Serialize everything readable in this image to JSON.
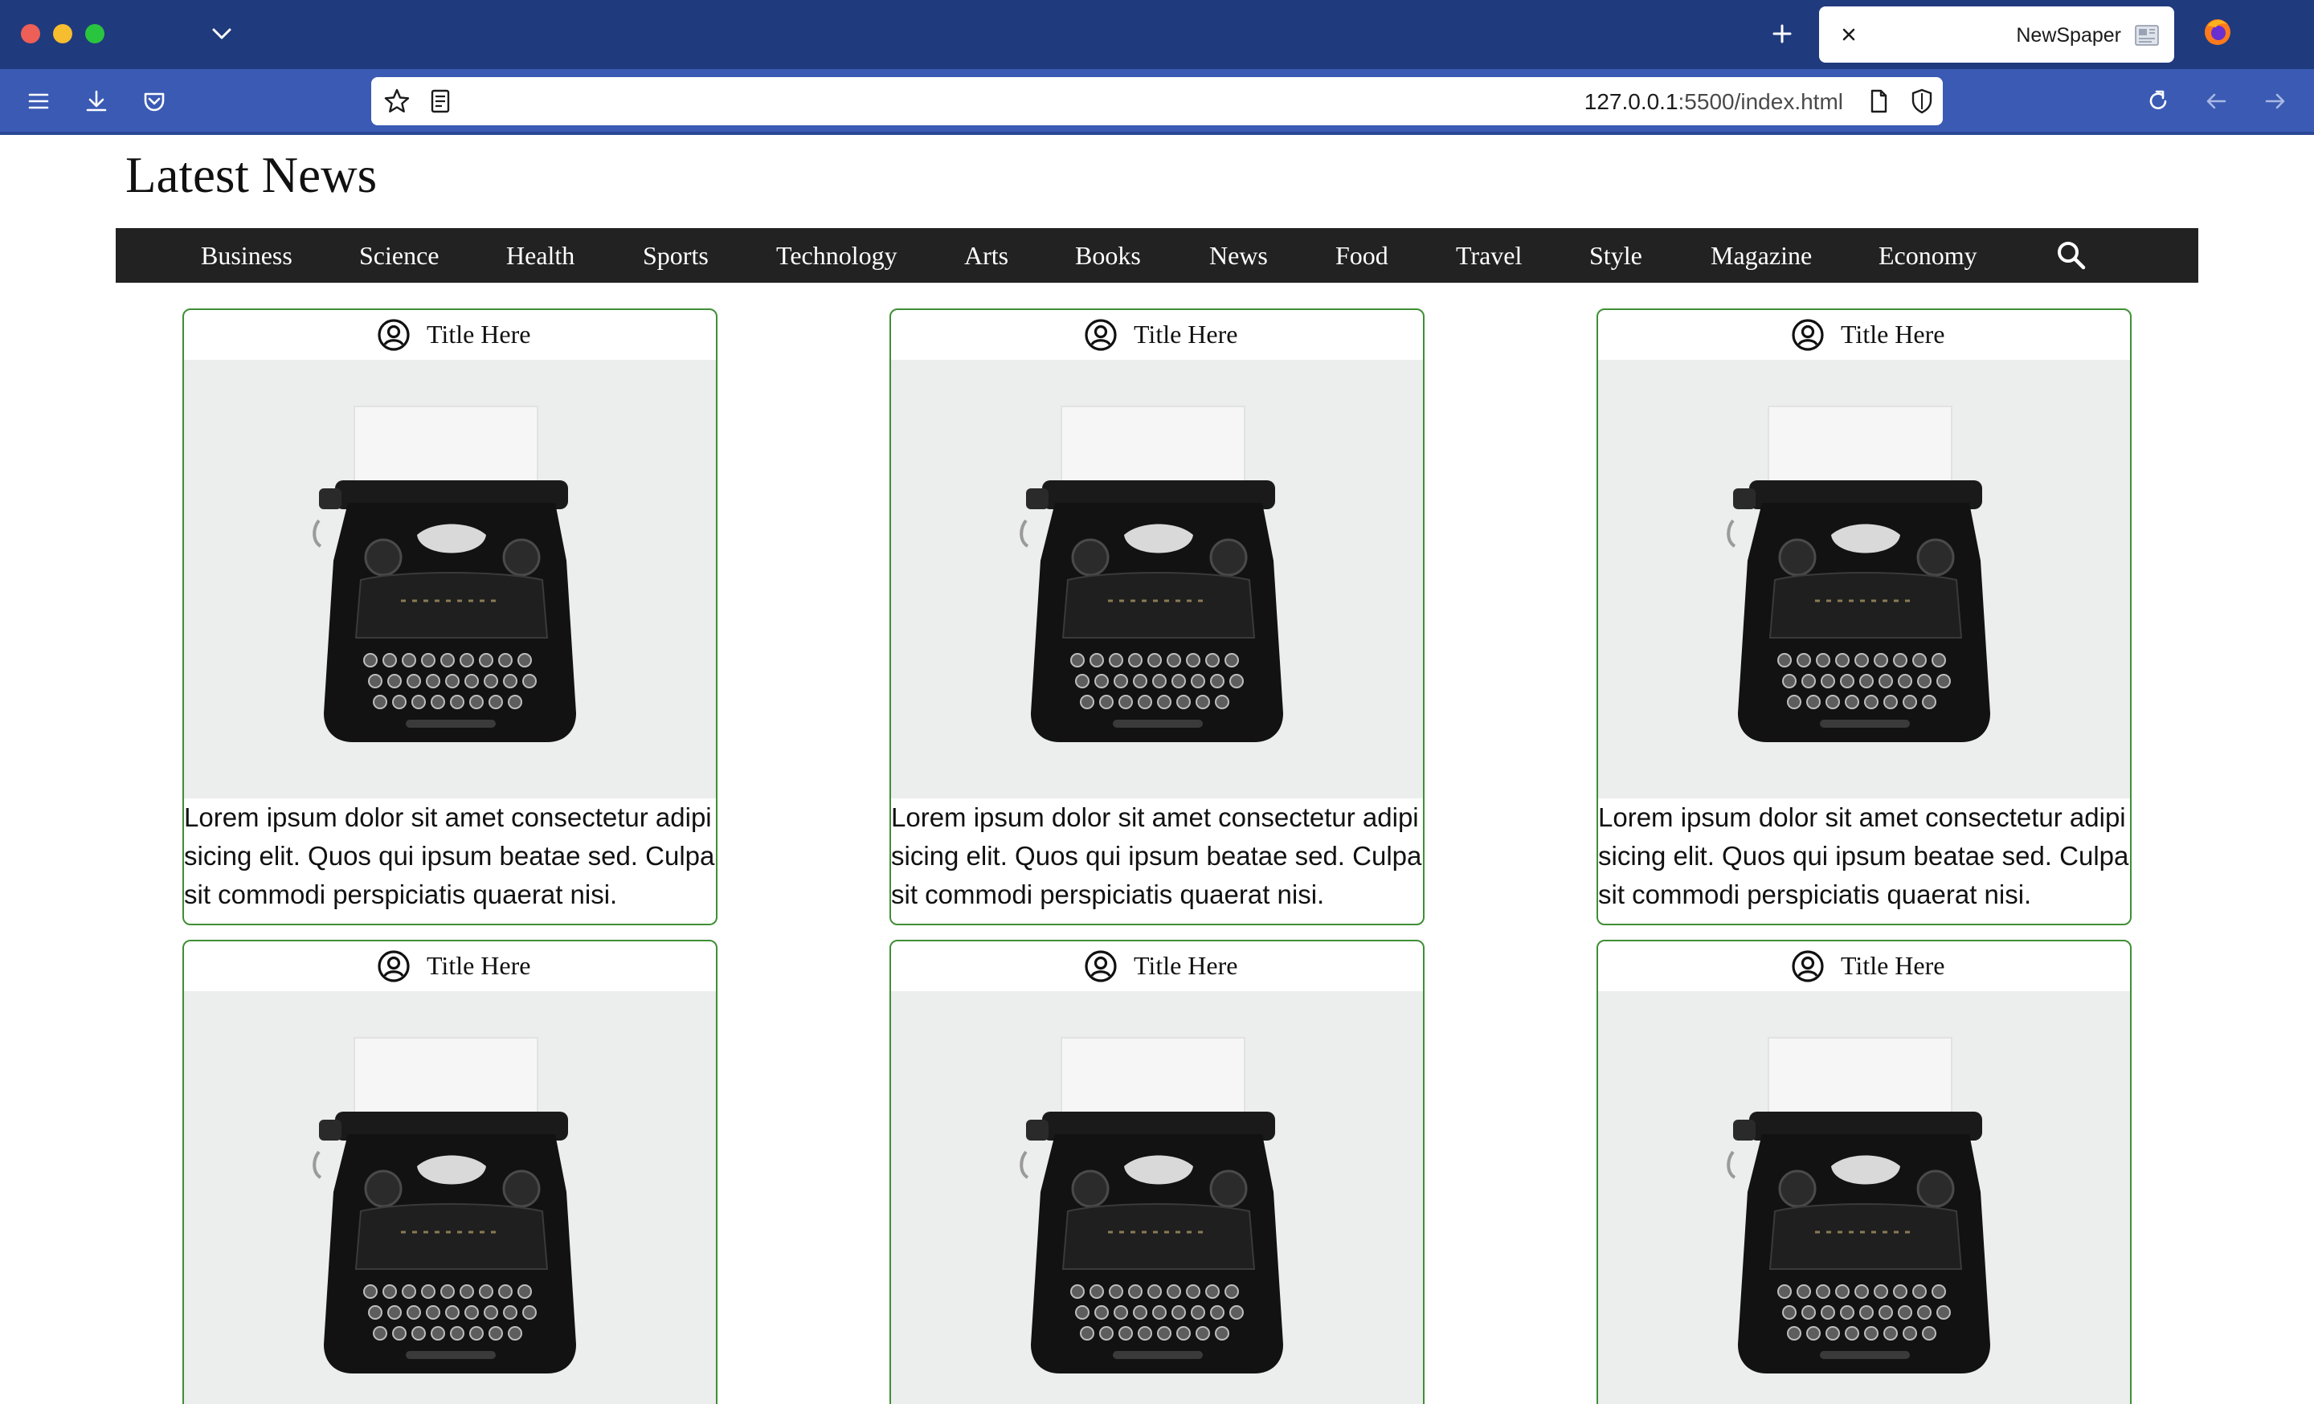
{
  "browser": {
    "tab_title": "NewSpaper",
    "url_host": "127.0.0.1",
    "url_rest": ":5500/index.html",
    "icons": [
      "tab-list-icon",
      "new-tab-icon",
      "close-icon",
      "firefox-icon",
      "menu-icon",
      "download-icon",
      "pocket-icon",
      "bookmark-star-icon",
      "reader-view-icon",
      "page-icon",
      "shield-icon",
      "reload-icon",
      "back-icon",
      "forward-icon"
    ]
  },
  "page": {
    "title": "Latest News"
  },
  "nav": {
    "items": [
      "Business",
      "Science",
      "Health",
      "Sports",
      "Technology",
      "Arts",
      "Books",
      "News",
      "Food",
      "Travel",
      "Style",
      "Magazine",
      "Economy"
    ],
    "search_icon": "search-icon"
  },
  "cards": [
    {
      "title": "Title Here",
      "text": "Lorem ipsum dolor sit amet consectetur adipisicing elit. Quos qui ipsum beatae sed. Culpa sit commodi perspiciatis quaerat nisi."
    },
    {
      "title": "Title Here",
      "text": "Lorem ipsum dolor sit amet consectetur adipisicing elit. Quos qui ipsum beatae sed. Culpa sit commodi perspiciatis quaerat nisi."
    },
    {
      "title": "Title Here",
      "text": "Lorem ipsum dolor sit amet consectetur adipisicing elit. Quos qui ipsum beatae sed. Culpa sit commodi perspiciatis quaerat nisi."
    },
    {
      "title": "Title Here",
      "text": ""
    },
    {
      "title": "Title Here",
      "text": ""
    },
    {
      "title": "Title Here",
      "text": ""
    }
  ],
  "colors": {
    "titlebar": "#1f3a7d",
    "toolbar": "#3a5ab4",
    "navbar": "#222222",
    "card_border": "#3f8f35"
  }
}
